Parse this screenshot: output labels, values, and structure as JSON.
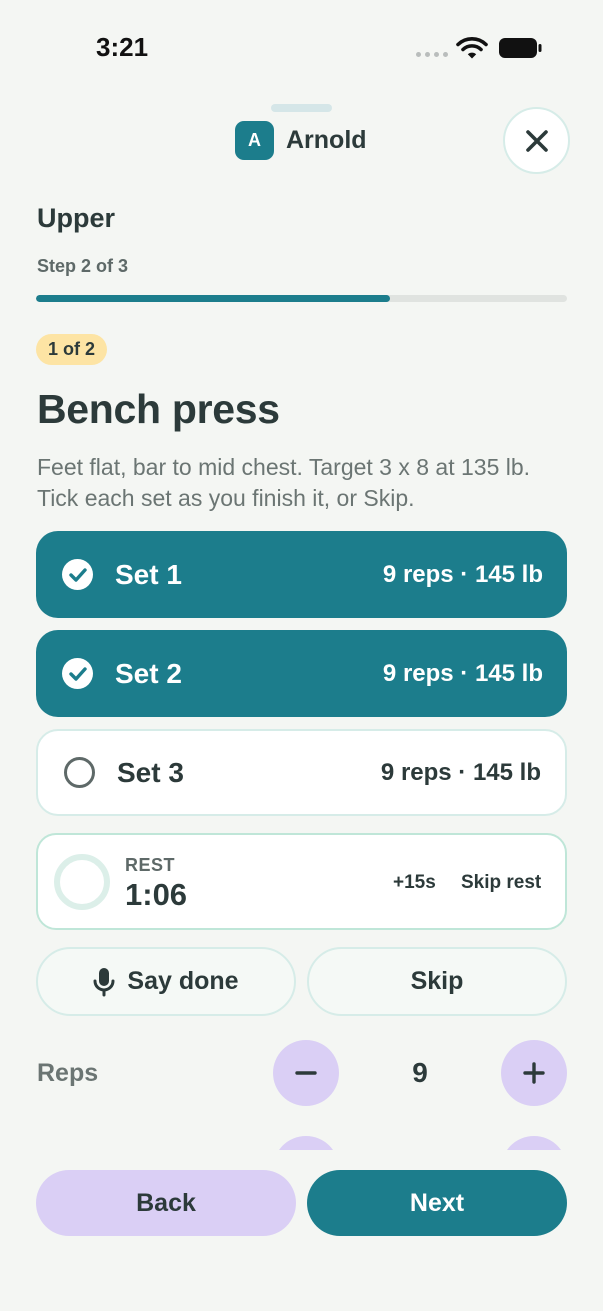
{
  "status_bar": {
    "time": "3:21"
  },
  "header": {
    "avatar_initial": "A",
    "user_name": "Arnold"
  },
  "workout": {
    "title": "Upper",
    "step_label": "Step 2 of 3",
    "progress_fraction": 0.667
  },
  "exercise": {
    "counter_badge": "1 of 2",
    "title": "Bench press",
    "description": "Feet flat, bar to mid chest. Target 3 x 8 at 135 lb. Tick each set as you finish it, or Skip.",
    "sets": [
      {
        "label": "Set 1",
        "detail": "9 reps · 145 lb",
        "done": true
      },
      {
        "label": "Set 2",
        "detail": "9 reps · 145 lb",
        "done": true
      },
      {
        "label": "Set 3",
        "detail": "9 reps · 145 lb",
        "done": false
      }
    ]
  },
  "rest": {
    "label": "REST",
    "time": "1:06",
    "add_label": "+15s",
    "skip_label": "Skip rest"
  },
  "actions": {
    "say_done_label": "Say done",
    "skip_label": "Skip"
  },
  "reps": {
    "label": "Reps",
    "value": "9"
  },
  "footer": {
    "back_label": "Back",
    "next_label": "Next"
  },
  "colors": {
    "primary": "#1c7d8c",
    "lavender": "#dacff5",
    "badge": "#fde4a4",
    "background": "#f4f6f3"
  }
}
